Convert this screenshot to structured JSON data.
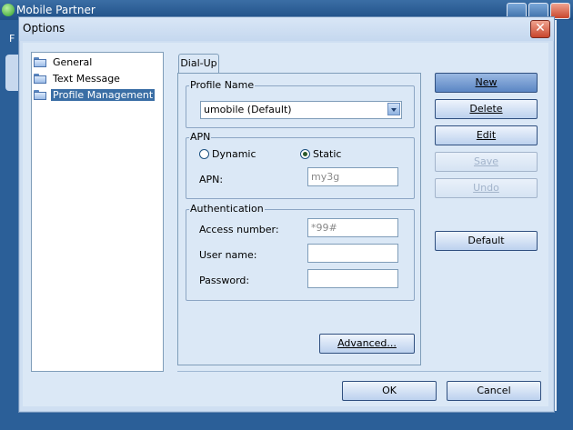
{
  "background_window": {
    "title": "Mobile Partner",
    "menu_letter": "F"
  },
  "dialog": {
    "title": "Options",
    "close_glyph": "✕"
  },
  "tree": {
    "items": [
      {
        "label": "General"
      },
      {
        "label": "Text Message"
      },
      {
        "label": "Profile Management",
        "selected": true
      }
    ]
  },
  "tab": {
    "label": "Dial-Up"
  },
  "profile_name": {
    "legend": "Profile Name",
    "selected_value": "umobile (Default)"
  },
  "apn": {
    "legend": "APN",
    "dynamic_label": "Dynamic",
    "static_label": "Static",
    "selected": "Static",
    "apn_label": "APN:",
    "apn_value": "my3g"
  },
  "authentication": {
    "legend": "Authentication",
    "access_number_label": "Access number:",
    "access_number_value": "*99#",
    "user_name_label": "User name:",
    "user_name_value": "",
    "password_label": "Password:",
    "password_value": ""
  },
  "buttons": {
    "new": "New",
    "delete": "Delete",
    "edit": "Edit",
    "save": "Save",
    "undo": "Undo",
    "default": "Default",
    "advanced": "Advanced...",
    "ok": "OK",
    "cancel": "Cancel"
  },
  "colors": {
    "accent": "#3a6ea5",
    "dialog_bg": "#dbe8f6",
    "close_button": "#c8452c"
  }
}
